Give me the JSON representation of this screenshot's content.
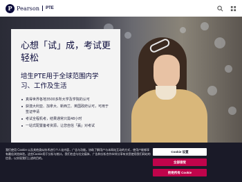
{
  "header": {
    "logo_text": "Pearson",
    "logo_sub": "PTE",
    "logo_mark": "P",
    "icons": [
      "search-icon",
      "menu-icon"
    ]
  },
  "hero": {
    "title": "心想「试」成，考试更轻松",
    "subtitle": "培生PTE用于全球范围内学习、工作及生活",
    "bullets": [
      "真得世界各地3500多所大学及学院的认可",
      "获澳大利亚、加拿大、新西兰、英国政府认可，可用于签证申请",
      "考试全程机考，结果通常只需48小时",
      "一站式配置备考资源，让您自信「赢」对考试"
    ]
  },
  "cookie": {
    "text": "我们使用 Cookie 以及其他类似技术进行个人化内容，广告与功能。协助了解用户与本网站互动的方式，使用户能够享有最佳浏览体验。这些Cookie用于分析与统计。我们也会与社交媒体、广告和分析合作伙伴分享有关您使用我们网站的信息，以实现我们上述的目的。",
    "settings_label": "Cookie 设置",
    "accept_label": "全部接受",
    "reject_label": "拒绝所有 Cookie"
  },
  "colors": {
    "brand_navy": "#0b0b3b",
    "accent_yellow": "#ffce00",
    "cookie_button": "#c0044b"
  }
}
